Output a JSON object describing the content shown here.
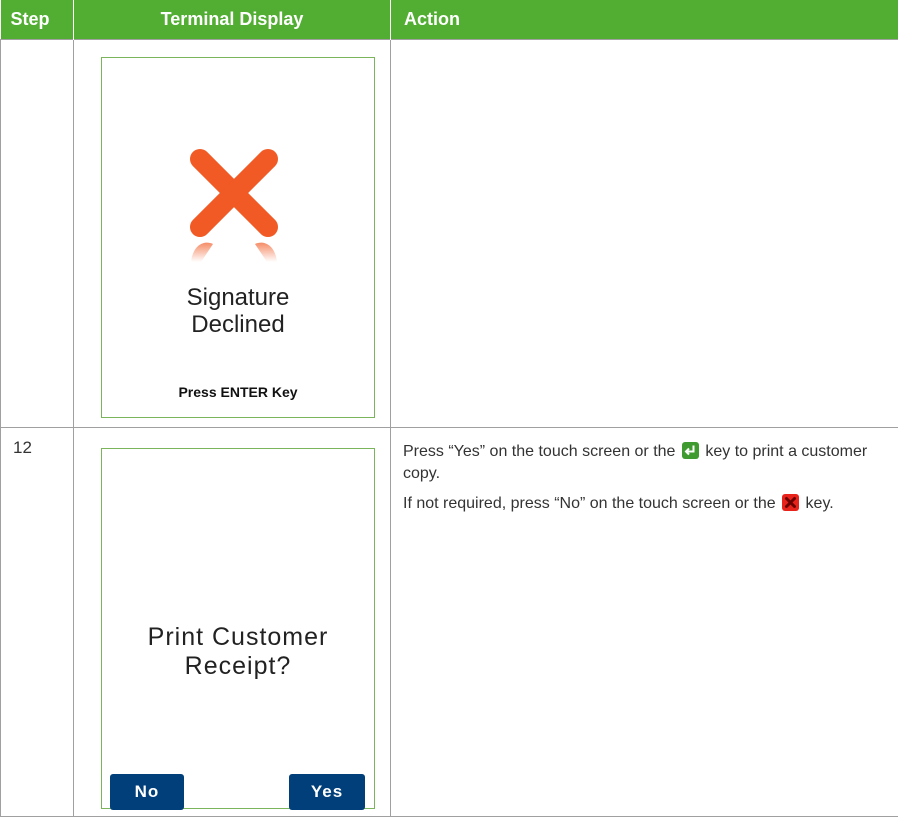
{
  "header": {
    "step": "Step",
    "terminal_display": "Terminal Display",
    "action": "Action"
  },
  "rows": [
    {
      "step": "",
      "screen": {
        "icon": "cancel-x-icon",
        "message_line1": "Signature",
        "message_line2": "Declined",
        "footer": "Press ENTER Key"
      },
      "action": ""
    },
    {
      "step": "12",
      "screen": {
        "prompt_line1": "Print Customer",
        "prompt_line2": "Receipt?",
        "no_button": "No",
        "yes_button": "Yes"
      },
      "action": {
        "line1_part1": "Press “Yes” on the touch screen or the",
        "line1_part2": "key to print a customer copy.",
        "line2_part1": "If not required, press “No” on the touch screen or the",
        "line2_part2": "key."
      }
    }
  ],
  "colors": {
    "header_green": "#52ae32",
    "screen_border": "#7ab55c",
    "x_red": "#f15a24",
    "button_blue": "#003f7a",
    "enter_key_green": "#3f9a2f",
    "cancel_key_red": "#e8231c"
  }
}
